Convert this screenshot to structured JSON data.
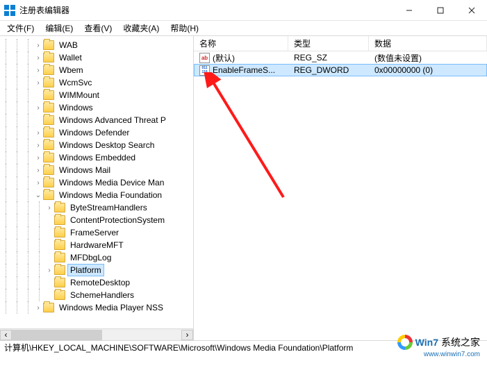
{
  "window": {
    "title": "注册表编辑器"
  },
  "menu": {
    "file": "文件(F)",
    "edit": "编辑(E)",
    "view": "查看(V)",
    "favorites": "收藏夹(A)",
    "help": "帮助(H)"
  },
  "tree": {
    "items": [
      {
        "depth": 3,
        "toggle": ">",
        "label": "WAB"
      },
      {
        "depth": 3,
        "toggle": ">",
        "label": "Wallet"
      },
      {
        "depth": 3,
        "toggle": ">",
        "label": "Wbem"
      },
      {
        "depth": 3,
        "toggle": ">",
        "label": "WcmSvc"
      },
      {
        "depth": 3,
        "toggle": "",
        "label": "WIMMount"
      },
      {
        "depth": 3,
        "toggle": ">",
        "label": "Windows"
      },
      {
        "depth": 3,
        "toggle": "",
        "label": "Windows Advanced Threat P"
      },
      {
        "depth": 3,
        "toggle": ">",
        "label": "Windows Defender"
      },
      {
        "depth": 3,
        "toggle": ">",
        "label": "Windows Desktop Search"
      },
      {
        "depth": 3,
        "toggle": ">",
        "label": "Windows Embedded"
      },
      {
        "depth": 3,
        "toggle": ">",
        "label": "Windows Mail"
      },
      {
        "depth": 3,
        "toggle": ">",
        "label": "Windows Media Device Man"
      },
      {
        "depth": 3,
        "toggle": "v",
        "label": "Windows Media Foundation"
      },
      {
        "depth": 4,
        "toggle": ">",
        "label": "ByteStreamHandlers"
      },
      {
        "depth": 4,
        "toggle": "",
        "label": "ContentProtectionSystem"
      },
      {
        "depth": 4,
        "toggle": "",
        "label": "FrameServer"
      },
      {
        "depth": 4,
        "toggle": "",
        "label": "HardwareMFT"
      },
      {
        "depth": 4,
        "toggle": "",
        "label": "MFDbgLog"
      },
      {
        "depth": 4,
        "toggle": ">",
        "label": "Platform",
        "selected": true
      },
      {
        "depth": 4,
        "toggle": "",
        "label": "RemoteDesktop"
      },
      {
        "depth": 4,
        "toggle": "",
        "label": "SchemeHandlers"
      },
      {
        "depth": 3,
        "toggle": ">",
        "label": "Windows Media Player NSS"
      }
    ]
  },
  "list": {
    "headers": {
      "name": "名称",
      "type": "类型",
      "data": "数据"
    },
    "rows": [
      {
        "icon": "ab",
        "name": "(默认)",
        "type": "REG_SZ",
        "data": "(数值未设置)",
        "selected": false
      },
      {
        "icon": "dw",
        "name": "EnableFrameS...",
        "type": "REG_DWORD",
        "data": "0x00000000 (0)",
        "selected": true
      }
    ]
  },
  "status": {
    "path": "计算机\\HKEY_LOCAL_MACHINE\\SOFTWARE\\Microsoft\\Windows Media Foundation\\Platform"
  },
  "watermark": {
    "brand": "Win7",
    "tag": "系统之家",
    "url": "www.winwin7.com"
  }
}
